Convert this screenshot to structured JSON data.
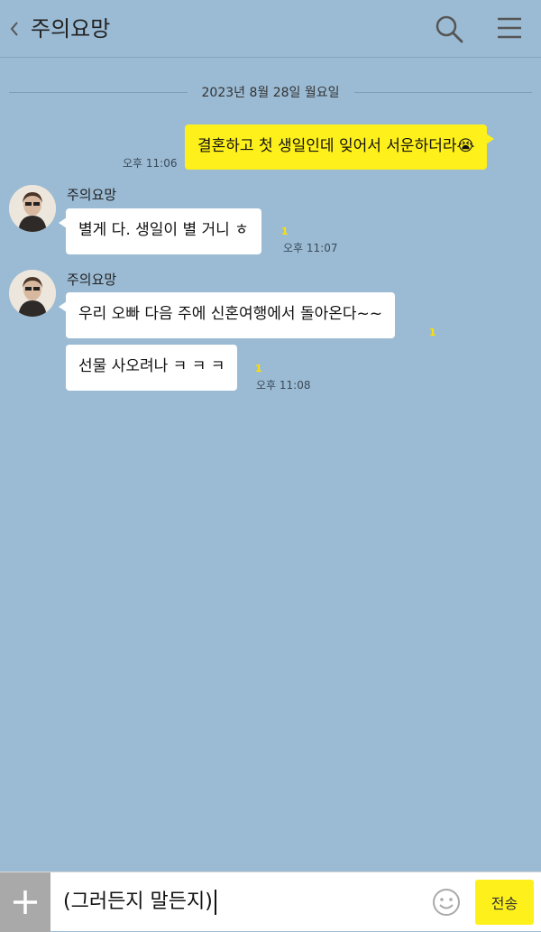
{
  "header": {
    "title": "주의요망",
    "back_icon": "chevron-left-icon",
    "search_icon": "search-icon",
    "menu_icon": "hamburger-menu-icon"
  },
  "date_divider": "2023년 8월 28일 월요일",
  "messages": [
    {
      "from": "me",
      "text": "결혼하고 첫 생일인데 잊어서 서운하더라",
      "emoji": "😭",
      "time": "오후 11:06"
    },
    {
      "from": "other",
      "sender": "주의요망",
      "text": "별게 다. 생일이 별 거니 ㅎ",
      "unread": "1",
      "time": "오후 11:07"
    },
    {
      "from": "other",
      "sender": "주의요망",
      "text": "우리 오빠 다음 주에 신혼여행에서 돌아온다~~",
      "unread": "1"
    },
    {
      "from": "other",
      "text": "선물 사오려나 ㅋ ㅋ ㅋ",
      "unread": "1",
      "time": "오후 11:08"
    }
  ],
  "input": {
    "value": "(그러든지 말든지)",
    "send_label": "전송",
    "plus_icon": "plus-icon",
    "emoji_icon": "emoticon-icon"
  },
  "colors": {
    "background": "#9bbbd4",
    "my_bubble": "#fef01b",
    "other_bubble": "#ffffff",
    "unread": "#ffe000",
    "plus_button": "#a9a9a9"
  }
}
